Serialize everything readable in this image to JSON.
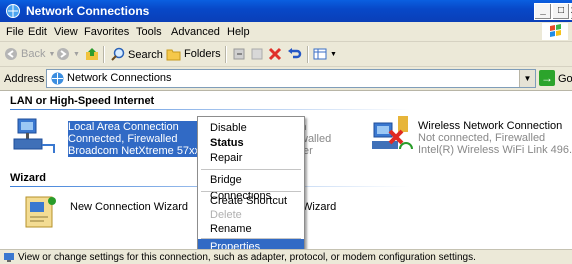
{
  "window": {
    "title": "Network Connections"
  },
  "menu": [
    "File",
    "Edit",
    "View",
    "Favorites",
    "Tools",
    "Advanced",
    "Help"
  ],
  "toolbar": {
    "back": "Back",
    "search": "Search",
    "folders": "Folders"
  },
  "address": {
    "label": "Address",
    "value": "Network Connections",
    "go": "Go"
  },
  "groups": {
    "lan": "LAN or High-Speed Internet",
    "wizard": "Wizard"
  },
  "connections": [
    {
      "name": "Local Area Connection",
      "status": "Connected, Firewalled",
      "device": "Broadcom NetXtreme 57xx Gig..."
    },
    {
      "name": "n",
      "status": "walled",
      "device": "ter"
    },
    {
      "name": "Wireless Network Connection",
      "status": "Not connected, Firewalled",
      "device": "Intel(R) Wireless WiFi Link 496..."
    }
  ],
  "wizards": [
    {
      "name": "New Connection Wizard"
    },
    {
      "name": "Wizard"
    }
  ],
  "context_menu": {
    "disable": "Disable",
    "status": "Status",
    "repair": "Repair",
    "bridge": "Bridge Connections",
    "shortcut": "Create Shortcut",
    "delete": "Delete",
    "rename": "Rename",
    "properties": "Properties"
  },
  "status_text": "View or change settings for this connection, such as adapter, protocol, or modem configuration settings.",
  "colors": {
    "titlebar": "#0a5fe0",
    "selection": "#316ac5",
    "chrome": "#ece9d8"
  }
}
